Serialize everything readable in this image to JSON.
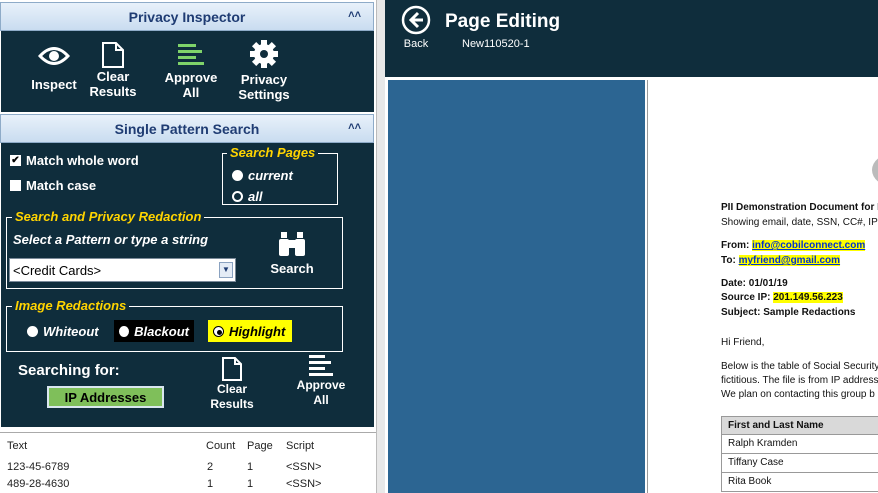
{
  "privacy_inspector": {
    "title": "Privacy Inspector",
    "collapse_glyph": "˄˄",
    "tools": [
      {
        "label": "Inspect",
        "icon": "eye-icon"
      },
      {
        "label": "Clear\nResults",
        "icon": "document-icon"
      },
      {
        "label": "Approve\nAll",
        "icon": "approve-lines-icon"
      },
      {
        "label": "Privacy\nSettings",
        "icon": "gear-icon"
      }
    ]
  },
  "single_pattern_search": {
    "title": "Single Pattern Search",
    "collapse_glyph": "˄˄",
    "match_whole_word": {
      "label": "Match whole word",
      "checked": true
    },
    "match_case": {
      "label": "Match case",
      "checked": false
    },
    "search_pages": {
      "legend": "Search Pages",
      "options": [
        {
          "label": "current",
          "selected": false
        },
        {
          "label": "all",
          "selected": true
        }
      ]
    },
    "redaction": {
      "legend": "Search and Privacy Redaction",
      "prompt": "Select a Pattern or type a string",
      "pattern_value": "<Credit Cards>",
      "search_label": "Search"
    },
    "image_redactions": {
      "legend": "Image Redactions",
      "options": [
        {
          "label": "Whiteout",
          "selected": false
        },
        {
          "label": "Blackout",
          "selected": false
        },
        {
          "label": "Highlight",
          "selected": true
        }
      ]
    },
    "searching_for": {
      "label": "Searching for:",
      "value": "IP Addresses"
    },
    "clear_results_label": "Clear\nResults",
    "approve_all_label": "Approve\nAll"
  },
  "results": {
    "columns": [
      "Text",
      "Count",
      "Page",
      "Script"
    ],
    "rows": [
      [
        "123-45-6789",
        "2",
        "1",
        "<SSN>"
      ],
      [
        "489-28-4630",
        "1",
        "1",
        "<SSN>"
      ]
    ]
  },
  "page_editing": {
    "title": "Page Editing",
    "back_label": "Back",
    "document_name": "New110520-1"
  },
  "document": {
    "title": "PII Demonstration Document for P",
    "subtitle": "Showing email, date, SSN, CC#, IP A",
    "from_label": "From:",
    "from_value": "info@cobilconnect.com",
    "to_label": "To:",
    "to_value": "myfriend@gmail.com",
    "date_line": "Date: 01/01/19",
    "source_ip_label": "Source IP:",
    "source_ip_value": "201.149.56.223",
    "subject_line": "Subject: Sample Redactions",
    "greeting": "Hi Friend,",
    "para": [
      "Below is the table of Social Security",
      "fictitious. The file is from IP address",
      "We plan on contacting this group b"
    ],
    "table_header": "First and Last Name",
    "names": [
      "Ralph Kramden",
      "Tiffany Case",
      "Rita Book"
    ]
  },
  "colors": {
    "panel_dark": "#0f2d3c",
    "legend_yellow": "#ffd400",
    "highlight": "#ffff00",
    "viewer_blue": "#2c6592",
    "searching_for_green": "#7fbf5a"
  }
}
